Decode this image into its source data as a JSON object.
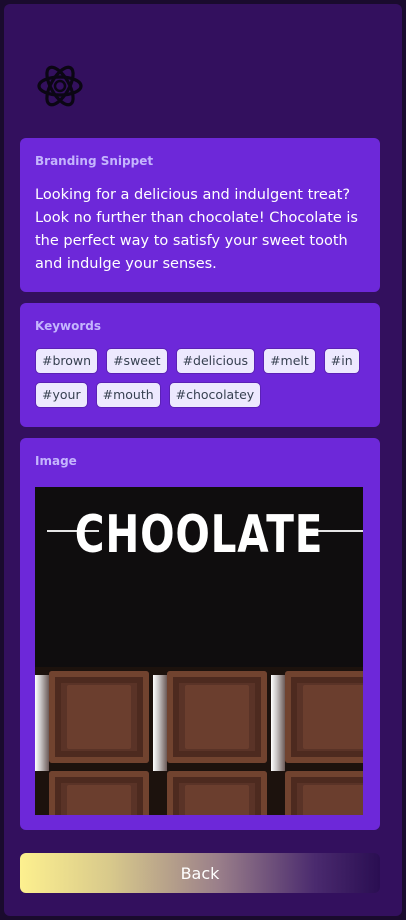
{
  "logo": {
    "icon": "flower-knot-icon"
  },
  "snippet": {
    "title": "Branding Snippet",
    "text": "Looking for a delicious and indulgent treat? Look no further than chocolate! Chocolate is the perfect way to satisfy your sweet tooth and indulge your senses."
  },
  "keywords": {
    "title": "Keywords",
    "items": [
      "#brown",
      "#sweet",
      "#delicious",
      "#melt",
      "#in",
      "#your",
      "#mouth",
      "#chocolatey"
    ]
  },
  "image": {
    "title": "Image",
    "heading": "CHOOLATE"
  },
  "actions": {
    "back_label": "Back"
  },
  "colors": {
    "background": "#33105e",
    "card": "#6d28d9",
    "card_title": "#c4b5fd",
    "chip": "#ede9fe"
  }
}
